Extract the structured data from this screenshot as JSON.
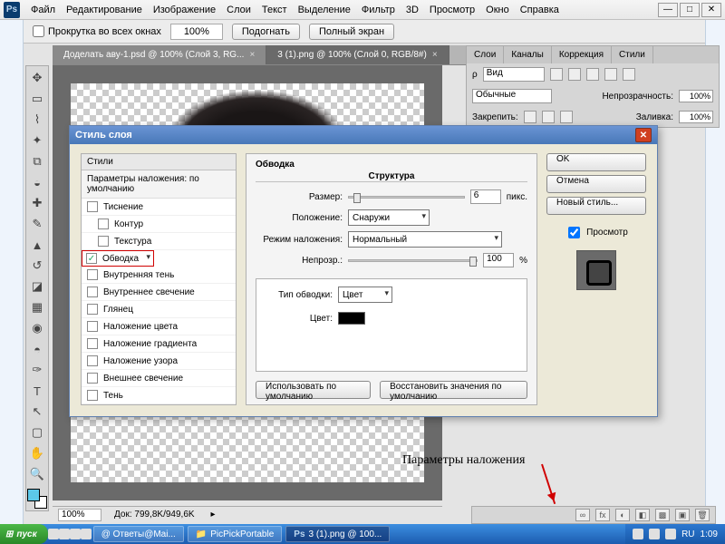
{
  "menubar": {
    "items": [
      "Файл",
      "Редактирование",
      "Изображение",
      "Слои",
      "Текст",
      "Выделение",
      "Фильтр",
      "3D",
      "Просмотр",
      "Окно",
      "Справка"
    ]
  },
  "optbar": {
    "scroll_all": "Прокрутка во всех окнах",
    "zoom": "100%",
    "fit": "Подогнать",
    "fullscreen": "Полный экран"
  },
  "tabs": [
    {
      "label": "Доделать аву-1.psd @ 100% (Слой 3, RG...",
      "active": false
    },
    {
      "label": "3 (1).png @ 100% (Слой 0, RGB/8#)",
      "active": true
    }
  ],
  "rpanel": {
    "tabs": [
      "Слои",
      "Каналы",
      "Коррекция",
      "Стили"
    ],
    "mode_sel": "Вид",
    "blend": "Обычные",
    "opacity_label": "Непрозрачность:",
    "opacity": "100%",
    "lock_label": "Закрепить:",
    "fill_label": "Заливка:",
    "fill": "100%"
  },
  "dialog": {
    "title": "Стиль слоя",
    "styles_hdr": "Стили",
    "styles_sub": "Параметры наложения: по умолчанию",
    "items": [
      {
        "label": "Тиснение",
        "checked": false,
        "indent": false
      },
      {
        "label": "Контур",
        "checked": false,
        "indent": true
      },
      {
        "label": "Текстура",
        "checked": false,
        "indent": true
      },
      {
        "label": "Обводка",
        "checked": true,
        "indent": false,
        "selected": true
      },
      {
        "label": "Внутренняя тень",
        "checked": false,
        "indent": false
      },
      {
        "label": "Внутреннее свечение",
        "checked": false,
        "indent": false
      },
      {
        "label": "Глянец",
        "checked": false,
        "indent": false
      },
      {
        "label": "Наложение цвета",
        "checked": false,
        "indent": false
      },
      {
        "label": "Наложение градиента",
        "checked": false,
        "indent": false
      },
      {
        "label": "Наложение узора",
        "checked": false,
        "indent": false
      },
      {
        "label": "Внешнее свечение",
        "checked": false,
        "indent": false
      },
      {
        "label": "Тень",
        "checked": false,
        "indent": false
      }
    ],
    "group": "Обводка",
    "subgroup": "Структура",
    "size_label": "Размер:",
    "size_val": "6",
    "size_unit": "пикс.",
    "position_label": "Положение:",
    "position_val": "Снаружи",
    "blend_label": "Режим наложения:",
    "blend_val": "Нормальный",
    "opacity_label": "Непрозр.:",
    "opacity_val": "100",
    "opacity_unit": "%",
    "filltype_label": "Тип обводки:",
    "filltype_val": "Цвет",
    "color_label": "Цвет:",
    "btn_default": "Использовать по умолчанию",
    "btn_reset": "Восстановить значения по умолчанию",
    "buttons": {
      "ok": "OK",
      "cancel": "Отмена",
      "newstyle": "Новый стиль..."
    },
    "preview_label": "Просмотр"
  },
  "annotation": "Параметры наложения",
  "statusbar": {
    "zoom": "100%",
    "doc": "Док: 799,8K/949,6K"
  },
  "layers_foot_icons": [
    "∞",
    "fx",
    "◐",
    "◧",
    "▩",
    "▣",
    "🗑"
  ],
  "taskbar": {
    "start": "пуск",
    "items": [
      {
        "label": "@ Ответы@Mai...",
        "active": false
      },
      {
        "label": "PicPickPortable",
        "active": false
      },
      {
        "label": "3 (1).png @ 100...",
        "active": true
      }
    ],
    "lang": "RU",
    "time": "1:09"
  }
}
